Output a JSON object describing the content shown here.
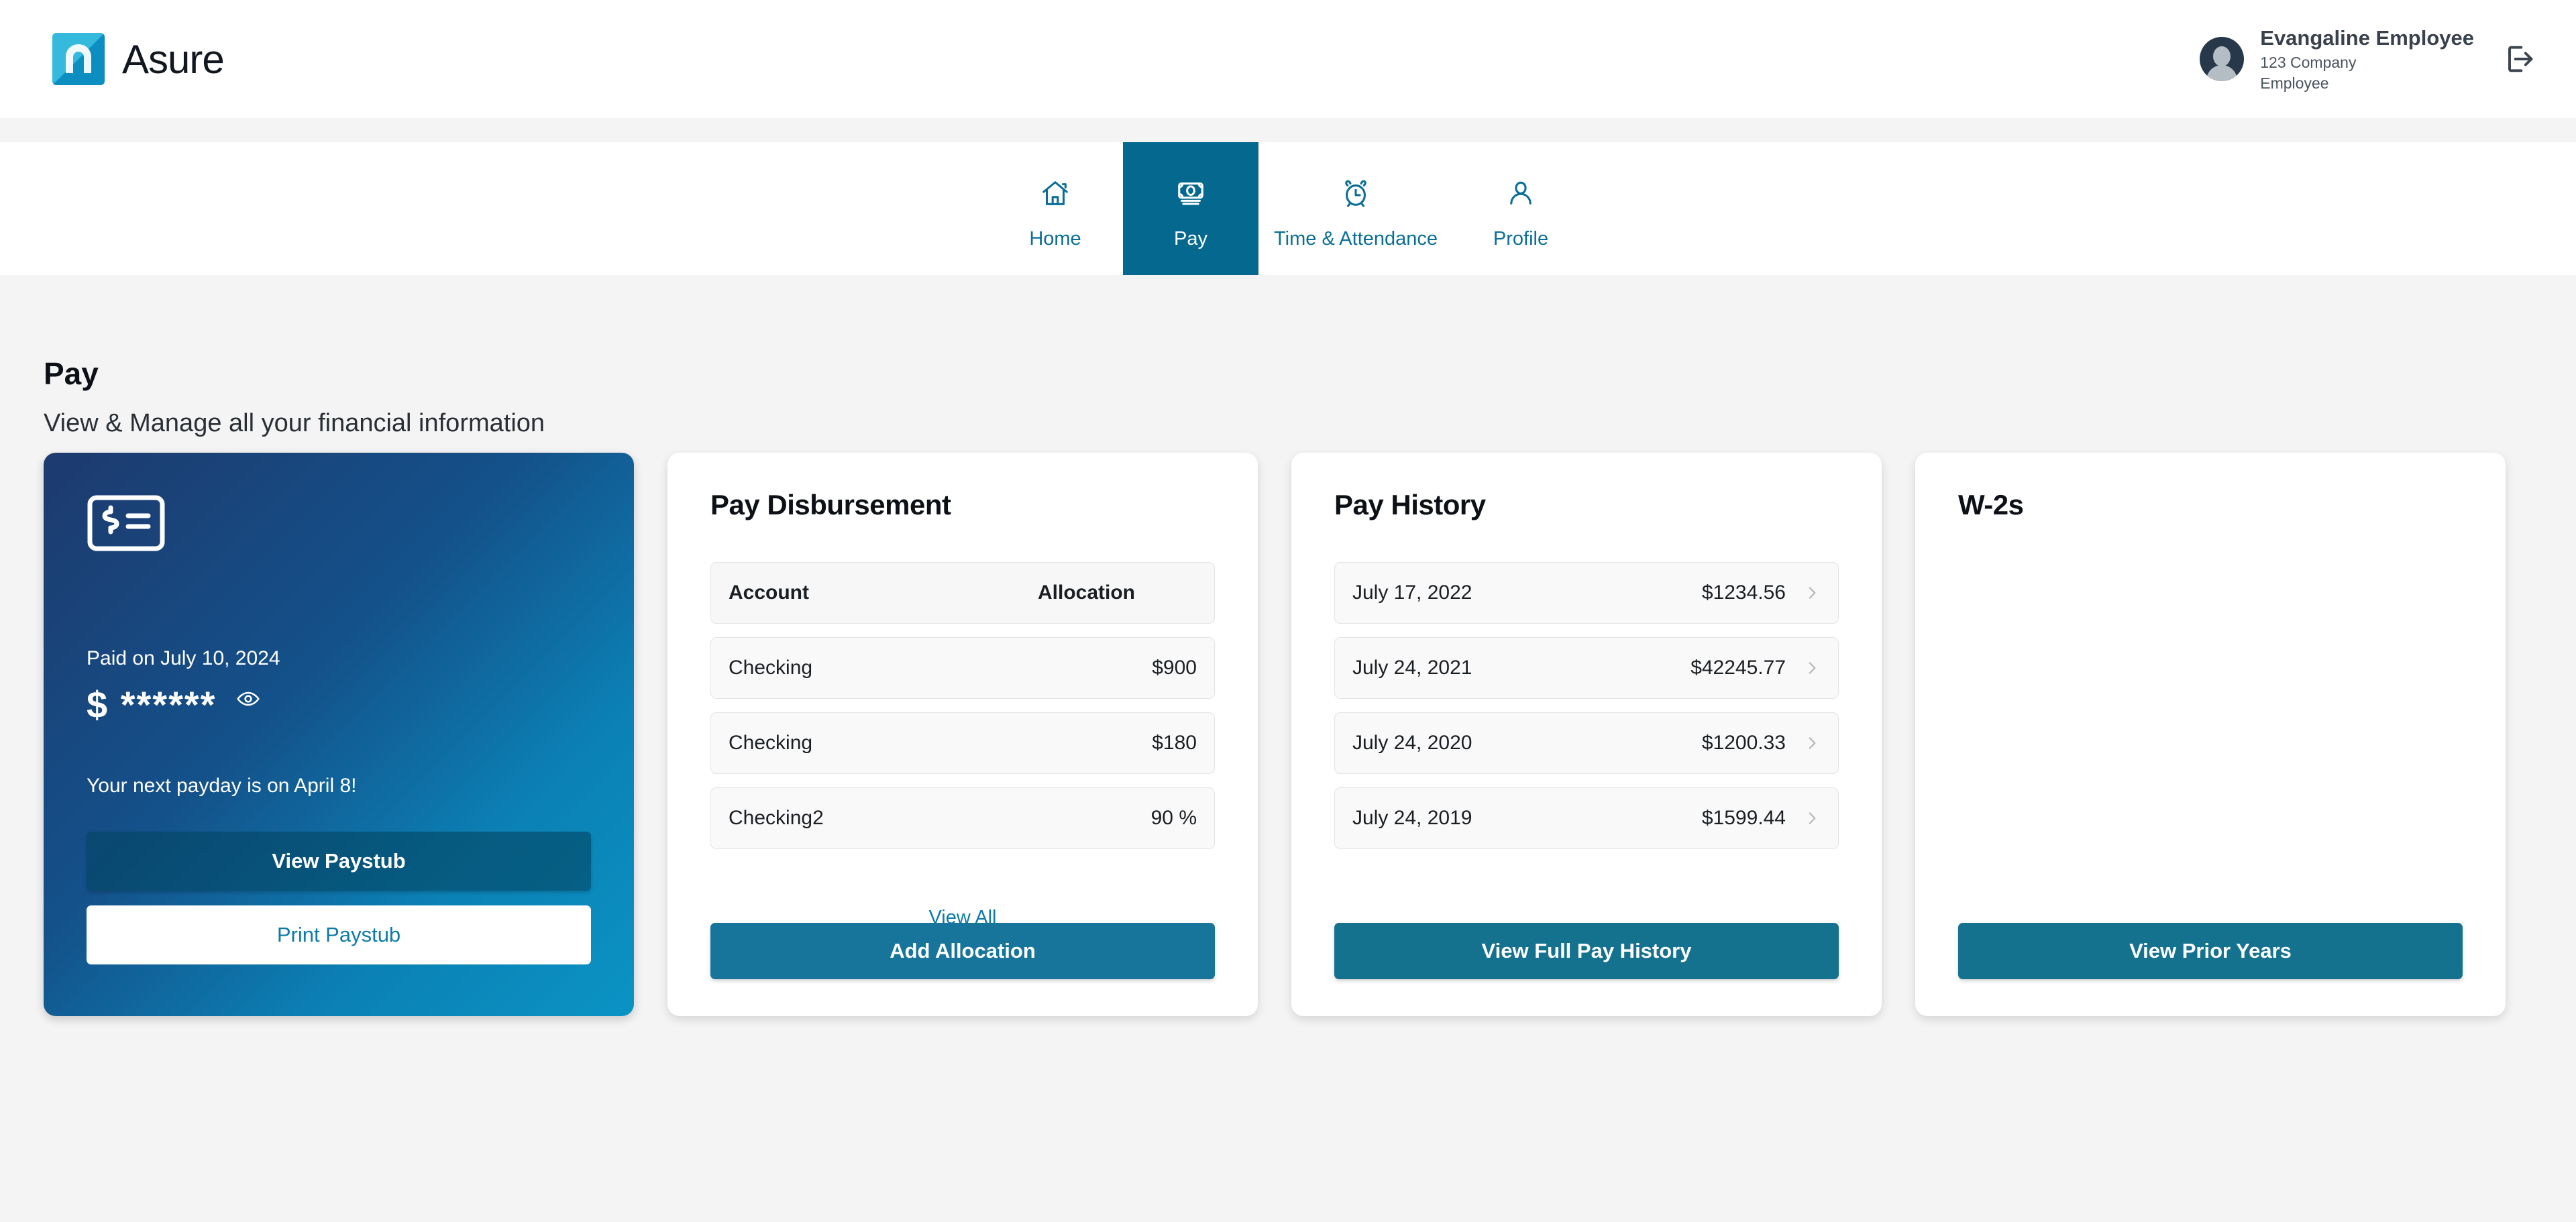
{
  "brand": {
    "name": "Asure",
    "logo_icon": "asure-logo-icon"
  },
  "header": {
    "user_name": "Evangaline Employee",
    "company": "123 Company",
    "role": "Employee",
    "avatar_icon": "avatar-icon",
    "logout_icon": "logout-icon"
  },
  "nav": {
    "items": [
      {
        "label": "Home",
        "icon": "home-icon",
        "active": false
      },
      {
        "label": "Pay",
        "icon": "banknote-icon",
        "active": true
      },
      {
        "label": "Time & Attendance",
        "icon": "alarm-clock-icon",
        "active": false
      },
      {
        "label": "Profile",
        "icon": "person-icon",
        "active": false
      }
    ]
  },
  "page": {
    "title": "Pay",
    "subtitle": "View & Manage all your financial information"
  },
  "paystub_card": {
    "icon": "paycheck-icon",
    "paid_on": "Paid on July 10, 2024",
    "amount_masked": "$ ******",
    "eye_icon": "eye-icon",
    "next_payday": "Your next payday is on April 8!",
    "view_button": "View Paystub",
    "print_button": "Print Paystub"
  },
  "disbursement_card": {
    "title": "Pay Disbursement",
    "columns": {
      "account": "Account",
      "allocation": "Allocation"
    },
    "rows": [
      {
        "account": "Checking",
        "allocation": "$900"
      },
      {
        "account": "Checking",
        "allocation": "$180"
      },
      {
        "account": "Checking2",
        "allocation": "90 %"
      }
    ],
    "view_all": "View All",
    "cta": "Add Allocation"
  },
  "pay_history_card": {
    "title": "Pay History",
    "rows": [
      {
        "date": "July 17, 2022",
        "amount": "$1234.56",
        "chevron": "chevron-right-icon"
      },
      {
        "date": "July 24, 2021",
        "amount": "$42245.77",
        "chevron": "chevron-right-icon"
      },
      {
        "date": "July 24, 2020",
        "amount": "$1200.33",
        "chevron": "chevron-right-icon"
      },
      {
        "date": "July 24, 2019",
        "amount": "$1599.44",
        "chevron": "chevron-right-icon"
      }
    ],
    "cta": "View Full Pay History"
  },
  "w2_card": {
    "title": "W-2s",
    "cta": "View Prior Years"
  },
  "colors": {
    "brand_teal": "#0a8fc0",
    "nav_active_bg": "#05688f",
    "nav_link": "#0a6e96",
    "cta_teal": "#15728f",
    "link_teal": "#0c7ba8",
    "page_bg": "#f4f4f4",
    "card_row_bg": "#f9f9f9"
  }
}
